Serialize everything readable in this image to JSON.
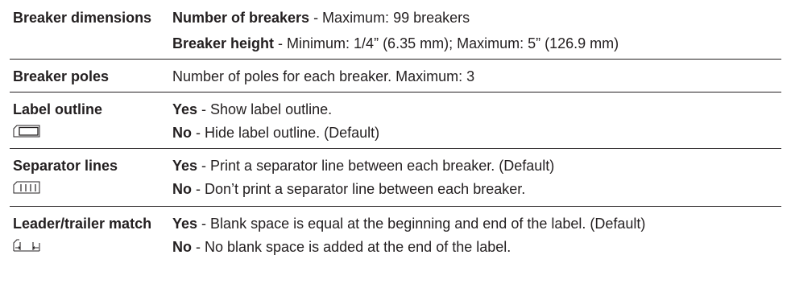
{
  "rows": [
    {
      "name": "Breaker dimensions",
      "lines": [
        {
          "bold": "Number of breakers",
          "text": " - Maximum: 99 breakers"
        },
        {
          "bold": "Breaker height",
          "text": " - Minimum: 1/4” (6.35 mm); Maximum: 5” (126.9 mm)"
        }
      ]
    },
    {
      "name": "Breaker poles",
      "lines": [
        {
          "bold": "",
          "text": "Number of poles for each breaker. Maximum: 3"
        }
      ]
    },
    {
      "name": "Label outline",
      "icon": "label-outline-icon",
      "lines": [
        {
          "bold": "Yes",
          "text": " - Show label outline."
        },
        {
          "bold": "No",
          "text": " - Hide label outline. (Default)"
        }
      ]
    },
    {
      "name": "Separator lines",
      "icon": "separator-lines-icon",
      "lines": [
        {
          "bold": "Yes",
          "text": " - Print a separator line between each breaker. (Default)"
        },
        {
          "bold": "No",
          "text": " - Don’t print a separator line between each breaker."
        }
      ]
    },
    {
      "name": "Leader/trailer match",
      "icon": "leader-trailer-match-icon",
      "lines": [
        {
          "bold": "Yes",
          "text": " - Blank space is equal at the beginning and end of the label. (Default)"
        },
        {
          "bold": "No",
          "text": " - No blank space is added at the end of the label."
        }
      ]
    }
  ]
}
